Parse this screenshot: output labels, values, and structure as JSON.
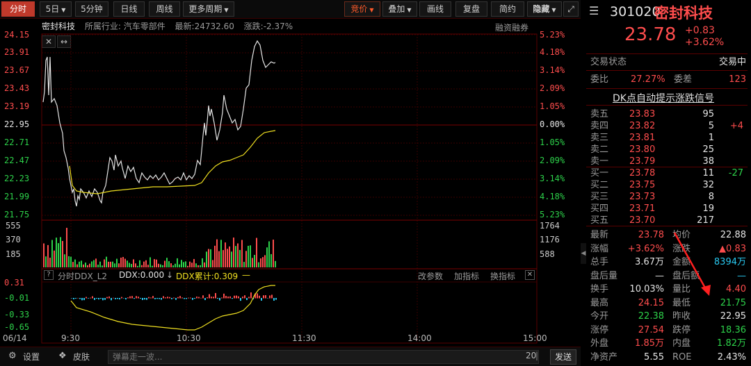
{
  "toolbar": {
    "tabs": [
      "分时",
      "5日",
      "5分钟",
      "日线",
      "周线",
      "更多周期"
    ],
    "right": [
      "竞价",
      "叠加",
      "画线",
      "复盘",
      "简约",
      "隐藏"
    ]
  },
  "chart": {
    "stock_name": "密封科技",
    "industry": "所属行业: 汽车零部件",
    "latest": "最新:24732.60",
    "change": "涨跌:-2.37%",
    "margin": "融资融券",
    "price_ticks": [
      "24.15",
      "23.91",
      "23.67",
      "23.43",
      "23.19",
      "22.95",
      "22.71",
      "22.47",
      "22.23",
      "21.99",
      "21.75"
    ],
    "pct_ticks": [
      "5.23%",
      "4.18%",
      "3.14%",
      "2.09%",
      "1.05%",
      "0.00%",
      "1.05%",
      "2.09%",
      "3.14%",
      "4.18%",
      "5.23%"
    ],
    "vol_ticks": [
      "555",
      "370",
      "185"
    ],
    "vol_right_ticks": [
      "1764",
      "1176",
      "588"
    ],
    "ddx_ticks": [
      "0.31",
      "-0.01",
      "-0.33",
      "-0.65"
    ],
    "ddx_header": {
      "q": "?",
      "name": "分时DDX_L2",
      "ddx": "DDX:0.000",
      "ddx_cum": "DDX累计:0.309",
      "modify": "改参数",
      "add": "加指标",
      "swap": "换指标"
    },
    "time_ticks": [
      "06/14",
      "9:30",
      "10:30",
      "11:30",
      "14:00",
      "15:00"
    ]
  },
  "quote": {
    "code": "301020",
    "name": "密封科技",
    "price": "23.78",
    "chg": "+0.83",
    "chg_pct": "+3.62%",
    "state_label": "交易状态",
    "state": "交易中",
    "weibi_label": "委比",
    "weibi": "27.27%",
    "weicha_label": "委差",
    "weicha": "123",
    "dk": "DK点自动提示涨跌信号",
    "asks": [
      {
        "label": "卖五",
        "price": "23.83",
        "vol": "95",
        "chg": ""
      },
      {
        "label": "卖四",
        "price": "23.82",
        "vol": "5",
        "chg": "+4"
      },
      {
        "label": "卖三",
        "price": "23.81",
        "vol": "1",
        "chg": ""
      },
      {
        "label": "卖二",
        "price": "23.80",
        "vol": "25",
        "chg": ""
      },
      {
        "label": "卖一",
        "price": "23.79",
        "vol": "38",
        "chg": ""
      }
    ],
    "bids": [
      {
        "label": "买一",
        "price": "23.78",
        "vol": "11",
        "chg": "-27"
      },
      {
        "label": "买二",
        "price": "23.75",
        "vol": "32",
        "chg": ""
      },
      {
        "label": "买三",
        "price": "23.73",
        "vol": "8",
        "chg": ""
      },
      {
        "label": "买四",
        "price": "23.71",
        "vol": "19",
        "chg": ""
      },
      {
        "label": "买五",
        "price": "23.70",
        "vol": "217",
        "chg": ""
      }
    ],
    "stats": [
      {
        "l1": "最新",
        "v1": "23.78",
        "c1": "red",
        "l2": "均价",
        "v2": "22.88",
        "c2": "white"
      },
      {
        "l1": "涨幅",
        "v1": "+3.62%",
        "c1": "red",
        "l2": "涨跌",
        "v2": "▲0.83",
        "c2": "red"
      },
      {
        "l1": "总手",
        "v1": "3.67万",
        "c1": "white",
        "l2": "金额",
        "v2": "8394万",
        "c2": "cyan"
      },
      {
        "l1": "盘后量",
        "v1": "—",
        "c1": "white",
        "l2": "盘后额",
        "v2": "—",
        "c2": "cyan"
      },
      {
        "l1": "换手",
        "v1": "10.03%",
        "c1": "white",
        "l2": "量比",
        "v2": "4.40",
        "c2": "red"
      },
      {
        "l1": "最高",
        "v1": "24.15",
        "c1": "red",
        "l2": "最低",
        "v2": "21.75",
        "c2": "green"
      },
      {
        "l1": "今开",
        "v1": "22.38",
        "c1": "green",
        "l2": "昨收",
        "v2": "22.95",
        "c2": "white"
      },
      {
        "l1": "涨停",
        "v1": "27.54",
        "c1": "red",
        "l2": "跌停",
        "v2": "18.36",
        "c2": "green"
      },
      {
        "l1": "外盘",
        "v1": "1.85万",
        "c1": "red",
        "l2": "内盘",
        "v2": "1.82万",
        "c2": "green"
      },
      {
        "l1": "净资产",
        "v1": "5.55",
        "c1": "white",
        "l2": "ROE",
        "v2": "2.43%",
        "c2": "white"
      }
    ]
  },
  "bottom": {
    "settings": "设置",
    "skin": "皮肤",
    "danmu_placeholder": "弹幕走一波...",
    "count": "20",
    "send": "发送"
  },
  "colors": {
    "up": "#ff4d4d",
    "down": "#2dd24a",
    "avg_line": "#f0e020",
    "price_line": "#e6e6e6"
  }
}
